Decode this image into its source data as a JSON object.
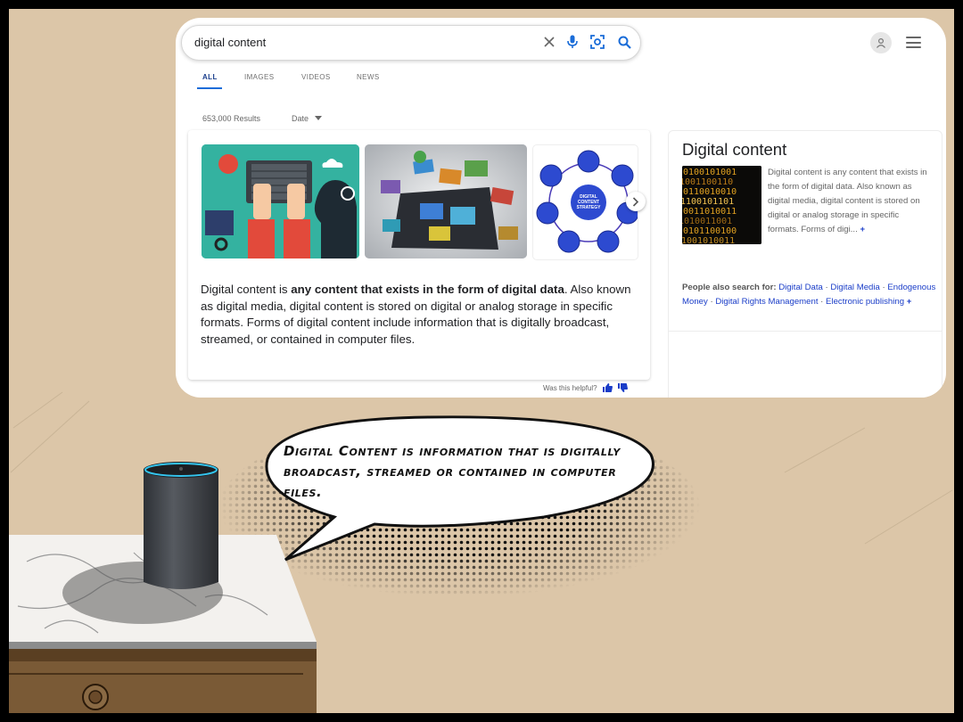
{
  "search": {
    "query": "digital content",
    "tabs": [
      {
        "label": "ALL",
        "active": true
      },
      {
        "label": "IMAGES",
        "active": false
      },
      {
        "label": "VIDEOS",
        "active": false
      },
      {
        "label": "NEWS",
        "active": false
      }
    ],
    "results_count": "653,000 Results",
    "date_filter": "Date"
  },
  "answer_card": {
    "snippet_prefix": "Digital content is ",
    "snippet_bold": "any content that exists in the form of digital data",
    "snippet_suffix": ". Also known as digital media, digital content is stored on digital or analog storage in specific formats. Forms of digital content include information that is digitally broadcast, streamed, or contained in computer files.",
    "helpful_label": "Was this helpful?",
    "strategy_image_text": "DIGITAL CONTENT STRATEGY"
  },
  "knowledge_panel": {
    "title": "Digital content",
    "description": "Digital content is any content that exists in the form of digital data. Also known as digital media, digital content is stored on digital or analog storage in specific formats. Forms of digi...",
    "more": "+",
    "people_also_search_label": "People also search for:",
    "related": [
      "Digital Data",
      "Digital Media",
      "Endogenous Money",
      "Digital Rights Management",
      "Electronic publishing"
    ],
    "related_more": "+"
  },
  "comic": {
    "speech": "Digital Content is information that is digitally broadcast, streamed or contained in computer files."
  },
  "icons": [
    "clear-icon",
    "microphone-icon",
    "lens-camera-icon",
    "search-icon",
    "account-icon",
    "menu-icon",
    "chevron-right-icon",
    "thumbs-up-icon",
    "thumbs-down-icon"
  ],
  "colors": {
    "accent": "#1a6cd8",
    "link": "#1a3dc8",
    "background": "#dcc6a8"
  }
}
